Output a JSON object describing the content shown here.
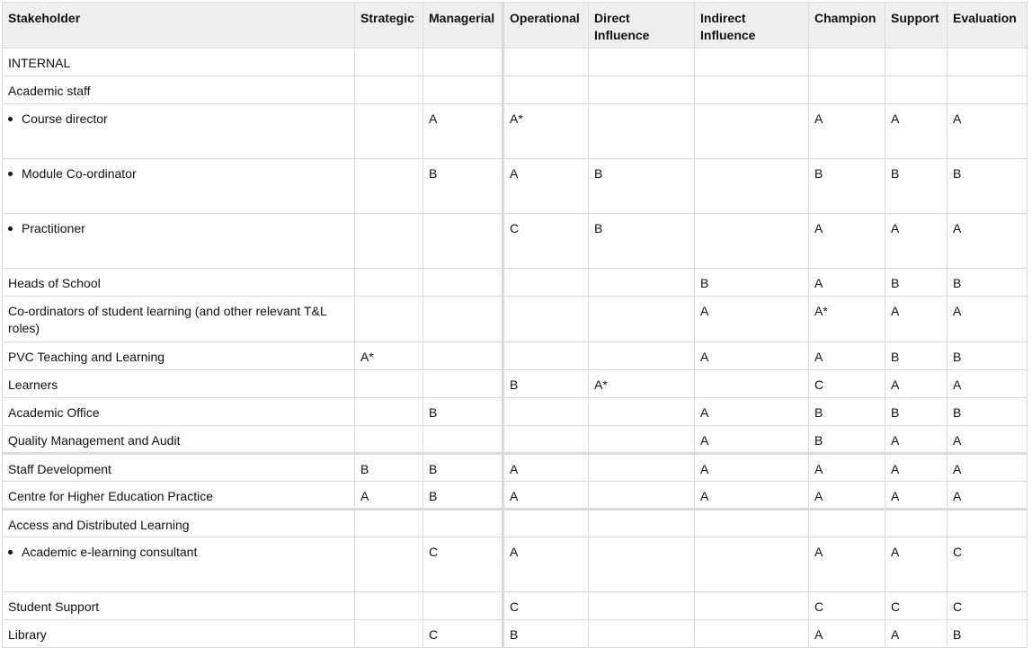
{
  "table": {
    "headers": [
      "Stakeholder",
      "Strategic",
      "Managerial",
      "Operational",
      "Direct Influence",
      "Indirect Influence",
      "Champion",
      "Support",
      "Evaluation"
    ],
    "rows": [
      {
        "label": "INTERNAL",
        "type": "section",
        "cells": [
          "",
          "",
          "",
          "",
          "",
          "",
          "",
          ""
        ]
      },
      {
        "label": "Academic staff",
        "type": "normal",
        "cells": [
          "",
          "",
          "",
          "",
          "",
          "",
          "",
          ""
        ]
      },
      {
        "label": "Course director",
        "type": "bullet",
        "cells": [
          "",
          "A",
          "A*",
          "",
          "",
          "A",
          "A",
          "A"
        ]
      },
      {
        "label": "Module Co-ordinator",
        "type": "bullet",
        "cells": [
          "",
          "B",
          "A",
          "B",
          "",
          "B",
          "B",
          "B"
        ]
      },
      {
        "label": "Practitioner",
        "type": "bullet",
        "cells": [
          "",
          "",
          "C",
          "B",
          "",
          "A",
          "A",
          "A"
        ]
      },
      {
        "label": "Heads of School",
        "type": "normal",
        "cells": [
          "",
          "",
          "",
          "",
          "B",
          "A",
          "B",
          "B"
        ]
      },
      {
        "label": "Co-ordinators of student learning (and other relevant T&L roles)",
        "type": "two-line",
        "cells": [
          "",
          "",
          "",
          "",
          "A",
          "A*",
          "A",
          "A"
        ]
      },
      {
        "label": "PVC Teaching and Learning",
        "type": "normal",
        "cells": [
          "A*",
          "",
          "",
          "",
          "A",
          "A",
          "B",
          "B"
        ]
      },
      {
        "label": "Learners",
        "type": "normal",
        "cells": [
          "",
          "",
          "B",
          "A*",
          "",
          "C",
          "A",
          "A"
        ]
      },
      {
        "label": "Academic Office",
        "type": "normal",
        "cells": [
          "",
          "B",
          "",
          "",
          "A",
          "B",
          "B",
          "B"
        ]
      },
      {
        "label": "Quality Management and Audit",
        "type": "normal",
        "thick_bottom": true,
        "cells": [
          "",
          "",
          "",
          "",
          "A",
          "B",
          "A",
          "A"
        ]
      },
      {
        "label": "Staff Development",
        "type": "normal",
        "cells": [
          "B",
          "B",
          "A",
          "",
          "A",
          "A",
          "A",
          "A"
        ]
      },
      {
        "label": "Centre for Higher Education Practice",
        "type": "normal",
        "thick_bottom": true,
        "cells": [
          "A",
          "B",
          "A",
          "",
          "A",
          "A",
          "A",
          "A"
        ]
      },
      {
        "label": "Access and Distributed Learning",
        "type": "normal",
        "cells": [
          "",
          "",
          "",
          "",
          "",
          "",
          "",
          ""
        ]
      },
      {
        "label": "Academic e-learning consultant",
        "type": "bullet",
        "cells": [
          "",
          "C",
          "A",
          "",
          "",
          "A",
          "A",
          "C"
        ]
      },
      {
        "label": "Student Support",
        "type": "normal",
        "cells": [
          "",
          "",
          "C",
          "",
          "",
          "C",
          "C",
          "C"
        ]
      },
      {
        "label": "Library",
        "type": "normal",
        "cells": [
          "",
          "C",
          "B",
          "",
          "",
          "A",
          "A",
          "B"
        ]
      }
    ]
  },
  "colors": {
    "header_bg": "#efefef",
    "border": "#dadada",
    "text": "#111111"
  },
  "icons": {
    "bullet": "bullet-icon"
  }
}
